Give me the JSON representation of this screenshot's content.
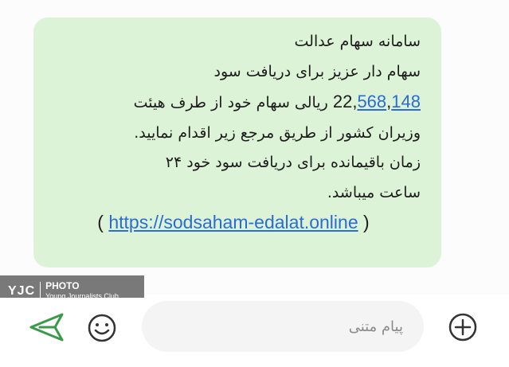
{
  "message": {
    "lines": [
      "سامانه سهام عدالت",
      "سهام دار عزیز برای دریافت سود",
      "",
      "وزیران کشور از طریق مرجع زیر اقدام نمایید.",
      "زمان باقیمانده برای دریافت سود خود ۲۴",
      "ساعت میباشد."
    ],
    "amount": {
      "part1": "22,",
      "part2": "568",
      "part3": ",",
      "part4": "148",
      "suffix": "ریالی سهام خود از طرف هیئت"
    },
    "link": {
      "open": "(",
      "url": "https://sodsaham-edalat.online",
      "close": ")"
    }
  },
  "watermark": {
    "brand": "YJC",
    "title": "PHOTO",
    "subtitle": "Young Journalists Club"
  },
  "composer": {
    "placeholder": "پیام متنی",
    "send_icon": "send-icon",
    "emoji_icon": "emoji-icon",
    "add_icon": "add-icon",
    "accent_color": "#3a9a4a"
  }
}
